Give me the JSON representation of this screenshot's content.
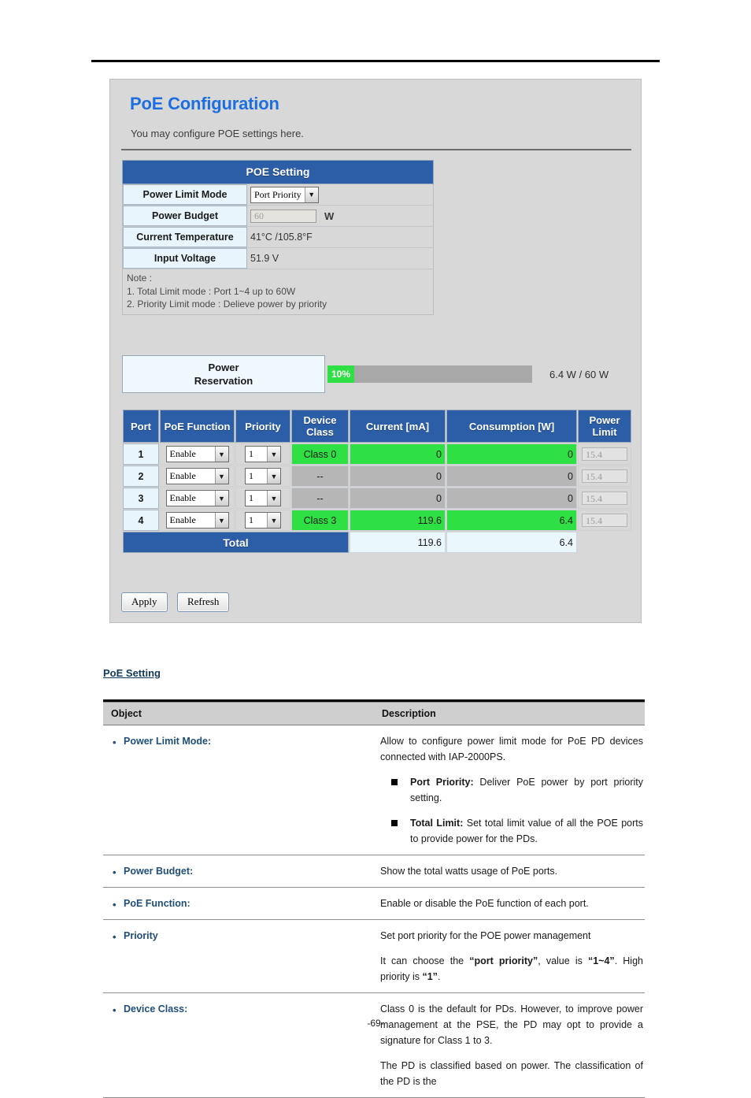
{
  "panel": {
    "title": "PoE Configuration",
    "subtitle": "You may configure POE settings here.",
    "setting_header": "POE Setting",
    "rows": [
      {
        "label": "Power Limit Mode",
        "value": "Port Priority",
        "type": "select"
      },
      {
        "label": "Power Budget",
        "value": "60",
        "unit": "W",
        "type": "text"
      },
      {
        "label": "Current Temperature",
        "value": "41°C /105.8°F",
        "type": "static"
      },
      {
        "label": "Input Voltage",
        "value": "51.9 V",
        "type": "static"
      }
    ],
    "note": {
      "heading": "Note :",
      "line1": "1. Total Limit mode : Port 1~4 up to 60W",
      "line2": "2. Priority Limit mode : Delieve power by priority"
    },
    "reservation": {
      "label_line1": "Power",
      "label_line2": "Reservation",
      "percent_text": "10%",
      "percent_value": 10,
      "value_text": "6.4 W / 60 W"
    },
    "port_table": {
      "headers": [
        "Port",
        "PoE Function",
        "Priority",
        "Device Class",
        "Current [mA]",
        "Consumption [W]",
        "Power Limit"
      ],
      "rows": [
        {
          "port": "1",
          "poe_function": "Enable",
          "priority": "1",
          "device_class": "Class 0",
          "current": "0",
          "consumption": "0",
          "power_limit": "15.4",
          "state": "active"
        },
        {
          "port": "2",
          "poe_function": "Enable",
          "priority": "1",
          "device_class": "--",
          "current": "0",
          "consumption": "0",
          "power_limit": "15.4",
          "state": "idle"
        },
        {
          "port": "3",
          "poe_function": "Enable",
          "priority": "1",
          "device_class": "--",
          "current": "0",
          "consumption": "0",
          "power_limit": "15.4",
          "state": "idle"
        },
        {
          "port": "4",
          "poe_function": "Enable",
          "priority": "1",
          "device_class": "Class 3",
          "current": "119.6",
          "consumption": "6.4",
          "power_limit": "15.4",
          "state": "active"
        }
      ],
      "total": {
        "label": "Total",
        "current": "119.6",
        "consumption": "6.4"
      }
    },
    "buttons": {
      "apply": "Apply",
      "refresh": "Refresh"
    },
    "colors": {
      "header_blue": "#2b5ea7",
      "title_blue": "#1d6fe0",
      "active_green": "#2ee043",
      "idle_grey": "#b6b6b6",
      "label_cyan": "#e8f5fc",
      "panel_grey": "#d8d8d8"
    }
  },
  "doc": {
    "section_title": "PoE Setting",
    "columns": {
      "object": "Object",
      "description": "Description"
    },
    "entries": [
      {
        "object": "Power Limit Mode:",
        "paragraphs": [
          "Allow to configure power limit mode for PoE PD devices connected with IAP-2000PS."
        ],
        "sub_items": [
          {
            "term": "Port Priority:",
            "text": " Deliver PoE power by port priority setting."
          },
          {
            "term": "Total Limit:",
            "text": " Set total limit value of all the POE ports to provide power for the PDs."
          }
        ]
      },
      {
        "object": "Power Budget:",
        "paragraphs": [
          "Show the total watts usage of PoE ports."
        ],
        "sub_items": []
      },
      {
        "object": "PoE Function:",
        "paragraphs": [
          "Enable or disable the PoE function of each port."
        ],
        "sub_items": []
      },
      {
        "object": "Priority",
        "paragraphs": [
          "Set port priority for the POE power management"
        ],
        "rich_line": {
          "a": "It can choose the ",
          "b1": "“port priority”",
          "c": ", value is ",
          "b2": "“1~4”",
          "d": ". High priority is ",
          "b3": "“1”",
          "e": "."
        },
        "sub_items": []
      },
      {
        "object": "Device Class:",
        "paragraphs": [
          "Class 0 is the default for PDs. However, to improve power management at the PSE, the PD may opt to provide a signature for Class 1 to 3.",
          "The PD is classified based on power. The classification of the PD is the"
        ],
        "sub_items": []
      }
    ]
  },
  "footer": {
    "page": "-69-"
  }
}
